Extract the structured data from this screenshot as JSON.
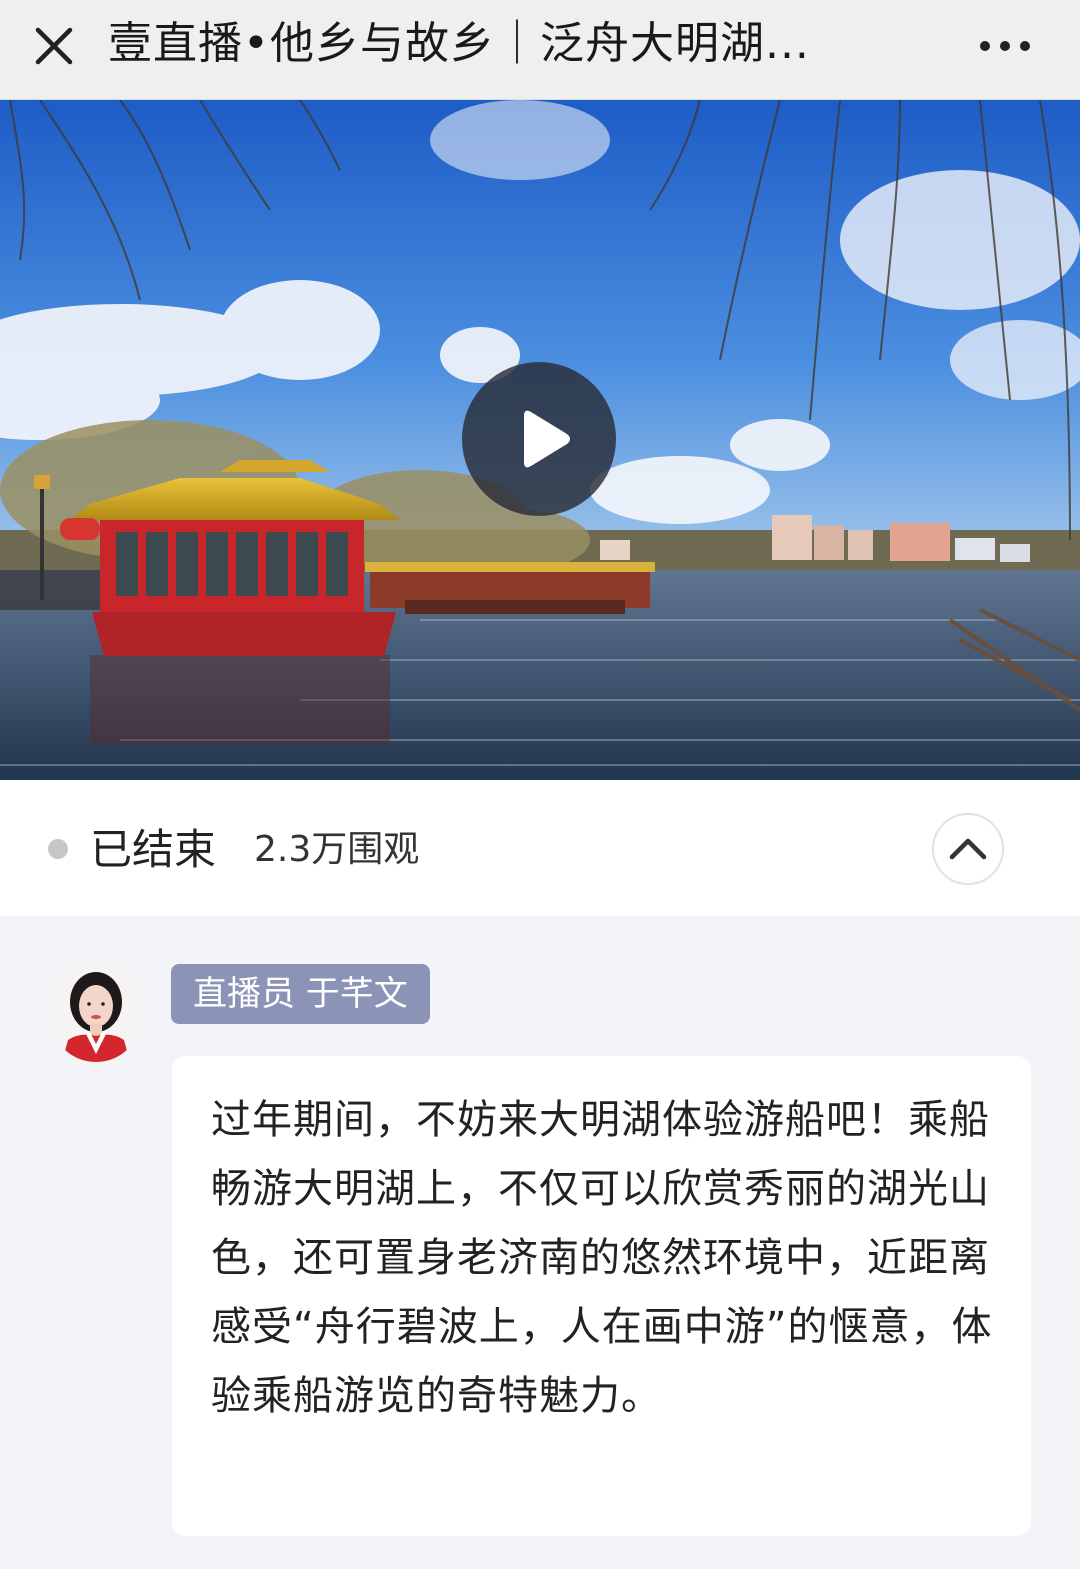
{
  "header": {
    "title": "壹直播•他乡与故乡｜泛舟大明湖...",
    "close_icon": "close-icon",
    "more_icon": "more-horizontal-icon"
  },
  "video": {
    "play_icon": "play-icon",
    "thumbnail": "Red-and-gold traditional tour boats moored on Daming Lake under a blue sky with willow branches"
  },
  "status": {
    "state": "已结束",
    "viewers": "2.3万围观",
    "collapse_icon": "chevron-up-icon"
  },
  "feed": {
    "anchor_badge": "直播员 于芊文",
    "message": "过年期间，不妨来大明湖体验游船吧！乘船畅游大明湖上，不仅可以欣赏秀丽的湖光山色，还可置身老济南的悠然环境中，近距离感受“舟行碧波上，人在画中游”的惬意，体验乘船游览的奇特魅力。"
  },
  "colors": {
    "badge_bg": "#8b93b7",
    "header_bg": "#efefef",
    "feed_bg": "#f3f4f8"
  }
}
